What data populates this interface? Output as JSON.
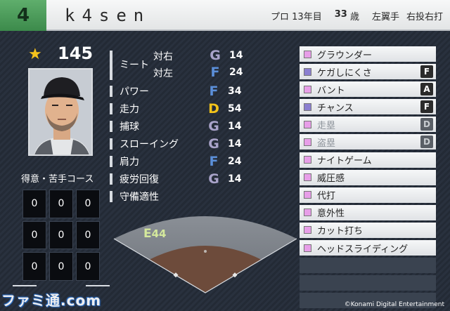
{
  "header": {
    "number": "4",
    "name": "k4sen",
    "career": "プロ 13年目",
    "age_num": "33",
    "age_unit": "歳",
    "position": "左翼手",
    "throw_bat": "右投右打"
  },
  "overall": {
    "value": "145"
  },
  "course": {
    "title": "得意・苦手コース",
    "cells": [
      "0",
      "0",
      "0",
      "0",
      "0",
      "0",
      "0",
      "0",
      "0"
    ]
  },
  "stats": {
    "meet": {
      "label": "ミート",
      "vs_right": {
        "label": "対右",
        "grade": "G",
        "value": "14"
      },
      "vs_left": {
        "label": "対左",
        "grade": "F",
        "value": "24"
      }
    },
    "rows": [
      {
        "label": "パワー",
        "grade": "F",
        "value": "34"
      },
      {
        "label": "走力",
        "grade": "D",
        "value": "54"
      },
      {
        "label": "捕球",
        "grade": "G",
        "value": "14"
      },
      {
        "label": "スローイング",
        "grade": "G",
        "value": "14"
      },
      {
        "label": "肩力",
        "grade": "F",
        "value": "24"
      },
      {
        "label": "疲労回復",
        "grade": "G",
        "value": "14"
      }
    ],
    "fielding_label": "守備適性",
    "fielding_grade": "E",
    "fielding_value": "44"
  },
  "grade_colors": {
    "G": "#a9a3c9",
    "F": "#5b8fd9",
    "D": "#f2c31a",
    "E": "#c9e07a"
  },
  "skills": [
    {
      "name": "グラウンダー",
      "color": "#e79ee8",
      "badge": ""
    },
    {
      "name": "ケガしにくさ",
      "color": "#8b7fd0",
      "badge": "F"
    },
    {
      "name": "バント",
      "color": "#e79ee8",
      "badge": "A"
    },
    {
      "name": "チャンス",
      "color": "#8b7fd0",
      "badge": "F"
    },
    {
      "name": "走塁",
      "color": "#e79ee8",
      "badge": "D",
      "dim": true
    },
    {
      "name": "盗塁",
      "color": "#e79ee8",
      "badge": "D",
      "dim": true
    },
    {
      "name": "ナイトゲーム",
      "color": "#e79ee8",
      "badge": ""
    },
    {
      "name": "威圧感",
      "color": "#e79ee8",
      "badge": ""
    },
    {
      "name": "代打",
      "color": "#e79ee8",
      "badge": ""
    },
    {
      "name": "意外性",
      "color": "#e79ee8",
      "badge": ""
    },
    {
      "name": "カット打ち",
      "color": "#e79ee8",
      "badge": ""
    },
    {
      "name": "ヘッドスライディング",
      "color": "#e79ee8",
      "badge": ""
    },
    {
      "name": "",
      "badge": ""
    },
    {
      "name": "",
      "badge": ""
    },
    {
      "name": "",
      "badge": ""
    }
  ],
  "footer": {
    "copyright": "©Konami Digital Entertainment",
    "watermark": "ファミ通.com"
  }
}
